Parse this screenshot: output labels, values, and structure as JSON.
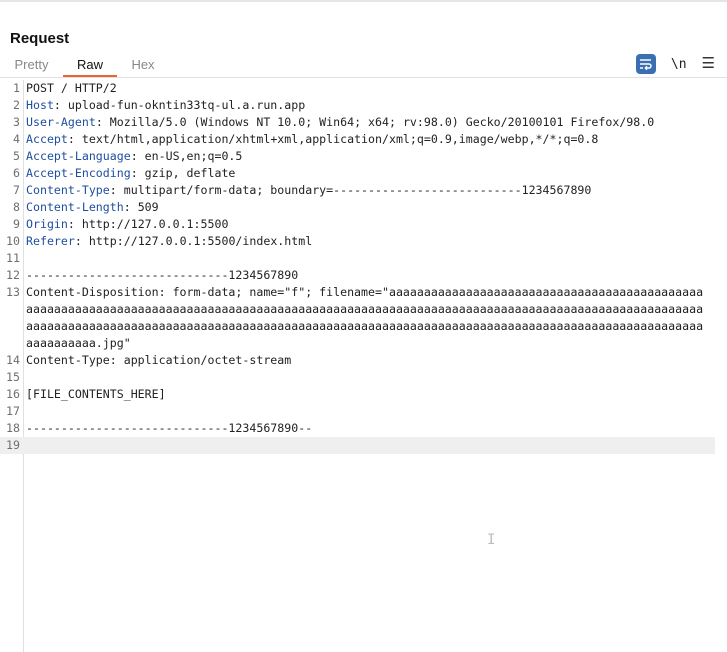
{
  "panel": {
    "title": "Request"
  },
  "tabs": [
    {
      "label": "Pretty"
    },
    {
      "label": "Raw"
    },
    {
      "label": "Hex"
    }
  ],
  "toolbar": {
    "wrap_icon": "word-wrap-icon",
    "newline_label": "\\n",
    "menu_icon": "hamburger-menu-icon"
  },
  "colors": {
    "accent": "#e8652c",
    "header_name": "#1f4fa0",
    "wrap_button": "#3a6fb1"
  },
  "lines": [
    {
      "n": "1",
      "text": "POST / HTTP/2"
    },
    {
      "n": "2",
      "name": "Host",
      "value": " upload-fun-okntin33tq-ul.a.run.app"
    },
    {
      "n": "3",
      "name": "User-Agent",
      "value": " Mozilla/5.0 (Windows NT 10.0; Win64; x64; rv:98.0) Gecko/20100101 Firefox/98.0"
    },
    {
      "n": "4",
      "name": "Accept",
      "value": " text/html,application/xhtml+xml,application/xml;q=0.9,image/webp,*/*;q=0.8"
    },
    {
      "n": "5",
      "name": "Accept-Language",
      "value": " en-US,en;q=0.5"
    },
    {
      "n": "6",
      "name": "Accept-Encoding",
      "value": " gzip, deflate"
    },
    {
      "n": "7",
      "name": "Content-Type",
      "value": " multipart/form-data; boundary=---------------------------1234567890"
    },
    {
      "n": "8",
      "name": "Content-Length",
      "value": " 509"
    },
    {
      "n": "9",
      "name": "Origin",
      "value": " http://127.0.0.1:5500"
    },
    {
      "n": "10",
      "name": "Referer",
      "value": " http://127.0.0.1:5500/index.html"
    },
    {
      "n": "11",
      "text": ""
    },
    {
      "n": "12",
      "text": "-----------------------------1234567890"
    },
    {
      "n": "13",
      "text": "Content-Disposition: form-data; name=\"f\"; filename=\"aaaaaaaaaaaaaaaaaaaaaaaaaaaaaaaaaaaaaaaaaaaaaaaaaaaaaaaaaaaaaaaaaaaaaaaaaaaaaaaaaaaaaaaaaaaaaaaaaaaaaaaaaaaaaaaaaaaaaaaaaaaaaaaaaaaaaaaaaaaaaaaaaaaaaaaaaaaaaaaaaaaaaaaaaaaaaaaaaaaaaaaaaaaaaaaaaaaaaaaaaaaaaaaaaaaaaaaaaaaaaaaaaaaaaaaaaaaaaaaaaaaaaaaaa.jpg\""
    },
    {
      "n": "14",
      "text": "Content-Type: application/octet-stream"
    },
    {
      "n": "15",
      "text": ""
    },
    {
      "n": "16",
      "text": "[FILE_CONTENTS_HERE]"
    },
    {
      "n": "17",
      "text": ""
    },
    {
      "n": "18",
      "text": "-----------------------------1234567890--"
    },
    {
      "n": "19",
      "text": "",
      "active": true
    }
  ]
}
